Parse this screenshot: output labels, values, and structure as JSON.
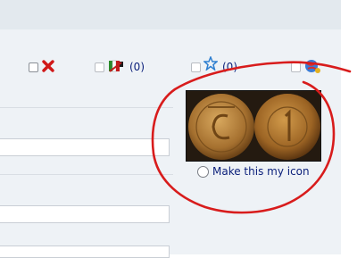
{
  "toolbar": {
    "delete": {
      "icon": "red-x-icon"
    },
    "flag": {
      "icon": "flag-icon",
      "count": "(0)"
    },
    "star": {
      "icon": "star-icon",
      "count": "(0)"
    },
    "globe": {
      "icon": "globe-icon"
    }
  },
  "avatar": {
    "image": "coin-pair-image",
    "radio_label": "Make this my icon"
  },
  "annotation": {
    "color": "#d81c1c"
  },
  "colors": {
    "link": "#0a1f7a",
    "panel": "#eef2f6",
    "header": "#e3e9ee"
  }
}
